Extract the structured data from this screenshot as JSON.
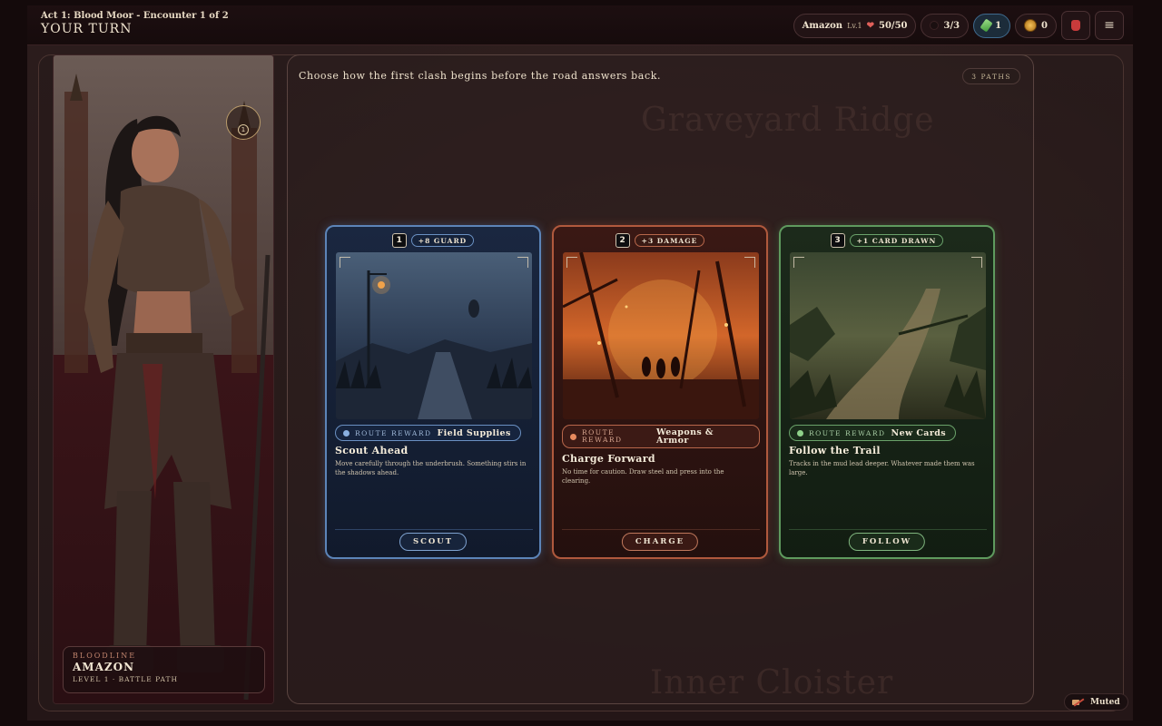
{
  "header": {
    "act": "Act 1: Blood Moor - Encounter 1 of 2",
    "turn": "YOUR TURN"
  },
  "hud": {
    "hero_name": "Amazon",
    "hero_level": "Lv.1",
    "hp": "50/50",
    "energy": "3/3",
    "potions": "1",
    "gold": "0",
    "menu_icon": "hamburger-menu-icon",
    "bag_icon": "red-bag-icon"
  },
  "map": {
    "labels": [
      "Graveyard Ridge",
      "Inner Cloister"
    ]
  },
  "hero_panel": {
    "badge": "1",
    "caption_key": "BLOODLINE",
    "caption_name": "AMAZON",
    "caption_sub": "LEVEL 1 · BATTLE PATH"
  },
  "choice": {
    "prompt": "Choose how the first clash begins before the road answers back.",
    "paths_count": "3 PATHS",
    "cards": [
      {
        "num": "1",
        "bonus": "+8 GUARD",
        "reward_key": "ROUTE REWARD",
        "reward_value": "Field Supplies",
        "title": "Scout Ahead",
        "desc": "Move carefully through the underbrush. Something stirs in the shadows ahead.",
        "button": "SCOUT"
      },
      {
        "num": "2",
        "bonus": "+3 DAMAGE",
        "reward_key": "ROUTE REWARD",
        "reward_value": "Weapons & Armor",
        "title": "Charge Forward",
        "desc": "No time for caution. Draw steel and press into the clearing.",
        "button": "CHARGE"
      },
      {
        "num": "3",
        "bonus": "+1 CARD DRAWN",
        "reward_key": "ROUTE REWARD",
        "reward_value": "New Cards",
        "title": "Follow the Trail",
        "desc": "Tracks in the mud lead deeper. Whatever made them was large.",
        "button": "FOLLOW"
      }
    ]
  },
  "audio": {
    "status": "Muted"
  },
  "colors": {
    "blue_accent": "#5c84b8",
    "red_accent": "#b0593d",
    "green_accent": "#5f9a5e",
    "hp_heart": "#e0605a"
  }
}
